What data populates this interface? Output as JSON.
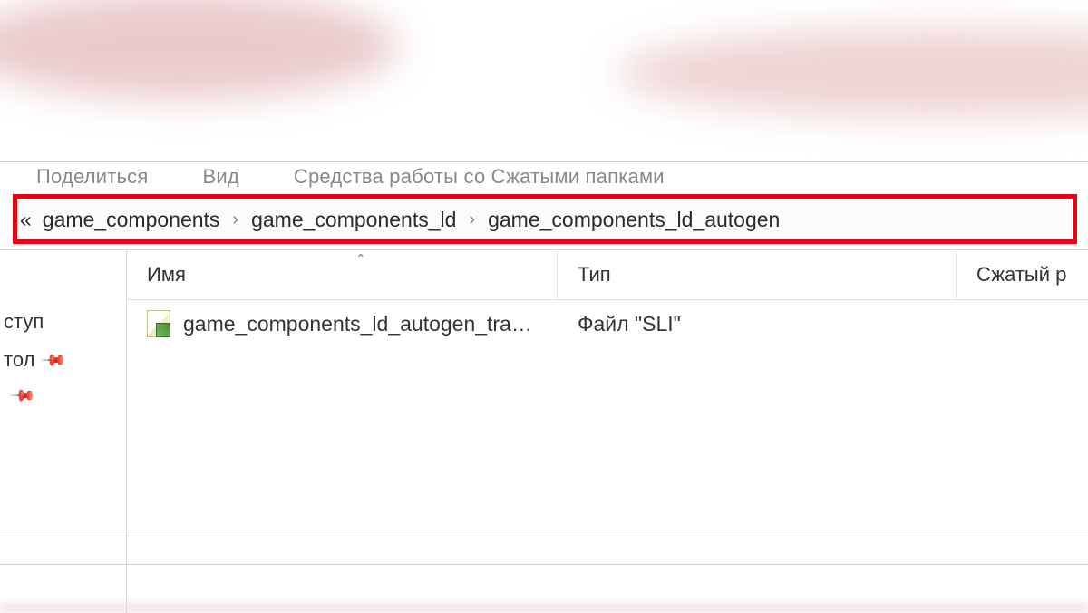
{
  "ribbon": {
    "share": "Поделиться",
    "view": "Вид",
    "tools": "Средства работы со Сжатыми папками"
  },
  "breadcrumb": {
    "overflow": "«",
    "segments": [
      "game_components",
      "game_components_ld",
      "game_components_ld_autogen"
    ]
  },
  "sidebar": {
    "items": [
      {
        "label": "ступ",
        "pin": false
      },
      {
        "label": "тол",
        "pin": true
      },
      {
        "label": "",
        "pin": true
      }
    ]
  },
  "columns": {
    "name": "Имя",
    "type": "Тип",
    "compressed": "Сжатый р"
  },
  "files": [
    {
      "name": "game_components_ld_autogen_tra…",
      "type": "Файл \"SLI\""
    }
  ]
}
